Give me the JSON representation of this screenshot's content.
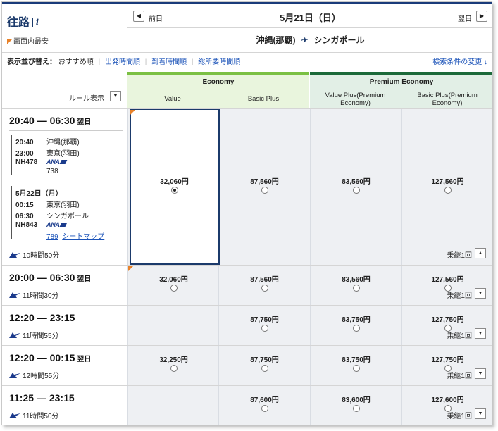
{
  "header": {
    "direction": "往路",
    "info_icon": "i",
    "cheapest_note": "画面内最安",
    "prev_label": "前日",
    "next_label": "翌日",
    "date": "5月21日（日）",
    "origin": "沖縄(那覇)",
    "destination": "シンガポール"
  },
  "sort": {
    "label": "表示並び替え：",
    "current": "おすすめ順",
    "options": [
      "出発時間順",
      "到着時間順",
      "総所要時間順"
    ],
    "search_change": "検索条件の変更",
    "search_change_icon": "down-arrow-icon"
  },
  "rule_label": "ルール表示",
  "cabins": [
    {
      "name": "Economy",
      "color": "#7bc043",
      "fares": [
        "Value",
        "Basic Plus"
      ]
    },
    {
      "name": "Premium Economy",
      "color": "#1c6a3a",
      "fares": [
        "Value Plus(Premium Economy)",
        "Basic Plus(Premium Economy)"
      ]
    }
  ],
  "flights": [
    {
      "dep": "20:40",
      "arr": "06:30",
      "next_day": "翌日",
      "expanded": true,
      "segments": [
        {
          "date": "",
          "dep_time": "20:40",
          "dep_airport": "沖縄(那覇)",
          "arr_time": "23:00",
          "arr_airport": "東京(羽田)",
          "flight_no": "NH478",
          "aircraft": "738",
          "seatmap": ""
        },
        {
          "date": "5月22日（月）",
          "dep_time": "00:15",
          "dep_airport": "東京(羽田)",
          "arr_time": "06:30",
          "arr_airport": "シンガポール",
          "flight_no": "NH843",
          "aircraft": "789",
          "seatmap": "シートマップ"
        }
      ],
      "duration": "10時間50分",
      "transfers": "乗継1回",
      "fares": [
        "32,060円",
        "87,560円",
        "83,560円",
        "127,560円"
      ],
      "selected": 0,
      "cheapest": true
    },
    {
      "dep": "20:00",
      "arr": "06:30",
      "next_day": "翌日",
      "duration": "11時間30分",
      "transfers": "乗継1回",
      "fares": [
        "32,060円",
        "87,560円",
        "83,560円",
        "127,560円"
      ],
      "cheapest": true
    },
    {
      "dep": "12:20",
      "arr": "23:15",
      "next_day": "",
      "duration": "11時間55分",
      "transfers": "乗継1回",
      "fares": [
        "",
        "87,750円",
        "83,750円",
        "127,750円"
      ]
    },
    {
      "dep": "12:20",
      "arr": "00:15",
      "next_day": "翌日",
      "duration": "12時間55分",
      "transfers": "乗継1回",
      "fares": [
        "32,250円",
        "87,750円",
        "83,750円",
        "127,750円"
      ]
    },
    {
      "dep": "11:25",
      "arr": "23:15",
      "next_day": "",
      "duration": "11時間50分",
      "transfers": "乗継1回",
      "fares": [
        "",
        "87,600円",
        "83,600円",
        "127,600円"
      ]
    }
  ],
  "airline": "ANA",
  "dash": "—"
}
